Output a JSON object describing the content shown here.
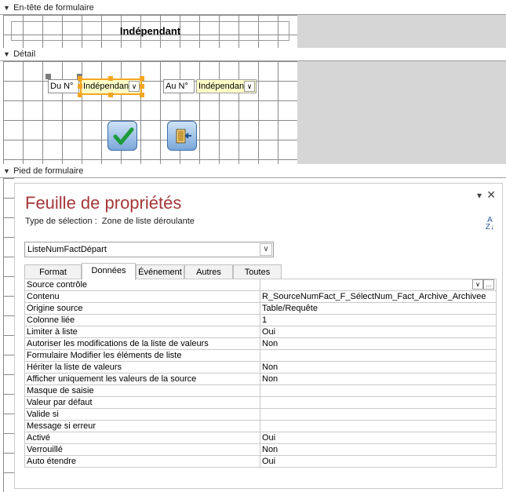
{
  "sections": {
    "header": "En-tête de formulaire",
    "detail": "Détail",
    "footer": "Pied de formulaire"
  },
  "form": {
    "header_label": "Indépendant",
    "from_label": "Du N°",
    "from_combo": "Indépendant",
    "to_label": "Au N°",
    "to_combo": "Indépendant"
  },
  "property_sheet": {
    "title": "Feuille de propriétés",
    "selection_type_label": "Type de sélection :",
    "selection_type_value": "Zone de liste déroulante",
    "selected_object": "ListeNumFactDépart",
    "tabs": [
      "Format",
      "Données",
      "Événement",
      "Autres",
      "Toutes"
    ],
    "active_tab": "Données",
    "rows": [
      {
        "name": "Source contrôle",
        "value": ""
      },
      {
        "name": "Contenu",
        "value": "R_SourceNumFact_F_SélectNum_Fact_Archive_Archivee"
      },
      {
        "name": "Origine source",
        "value": "Table/Requête"
      },
      {
        "name": "Colonne liée",
        "value": "1"
      },
      {
        "name": "Limiter à liste",
        "value": "Oui"
      },
      {
        "name": "Autoriser les modifications de la liste de valeurs",
        "value": "Non"
      },
      {
        "name": "Formulaire Modifier les éléments de liste",
        "value": ""
      },
      {
        "name": "Hériter la liste de valeurs",
        "value": "Non"
      },
      {
        "name": "Afficher uniquement les valeurs de la source",
        "value": "Non"
      },
      {
        "name": "Masque de saisie",
        "value": ""
      },
      {
        "name": "Valeur par défaut",
        "value": ""
      },
      {
        "name": "Valide si",
        "value": ""
      },
      {
        "name": "Message si erreur",
        "value": ""
      },
      {
        "name": "Activé",
        "value": "Oui"
      },
      {
        "name": "Verrouillé",
        "value": "Non"
      },
      {
        "name": "Auto étendre",
        "value": "Oui"
      }
    ]
  },
  "colors": {
    "title_red": "#a4373a",
    "selection_orange": "#f5a623",
    "combo_yellow": "#ffffc8"
  }
}
